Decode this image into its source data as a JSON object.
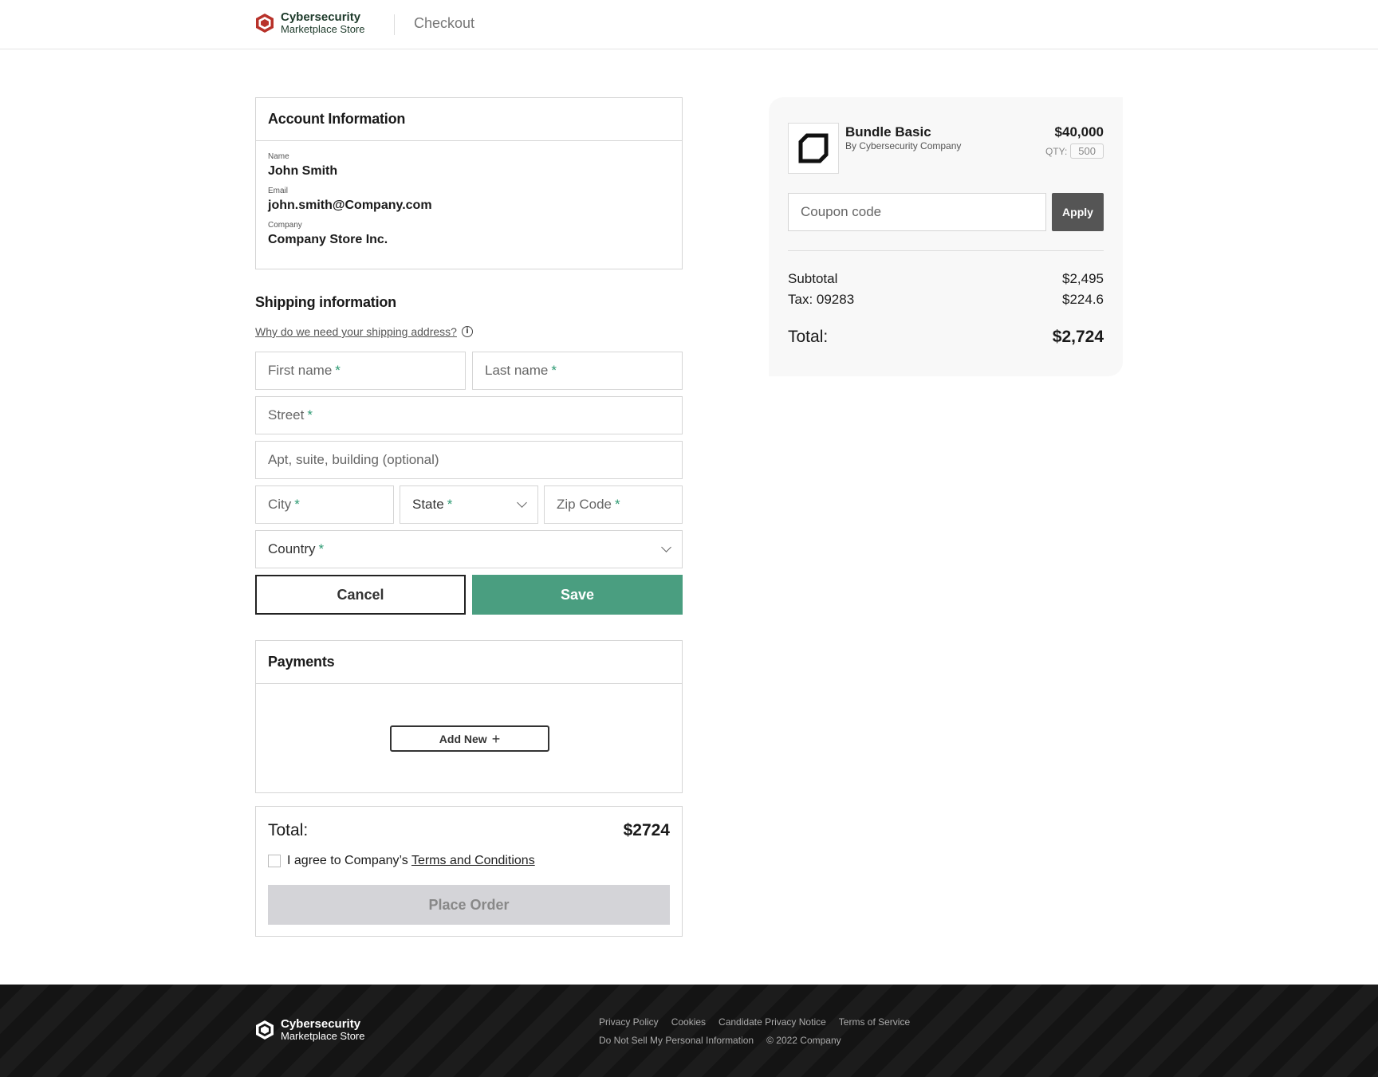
{
  "header": {
    "brand_line1": "Cybersecurity",
    "brand_line2": "Marketplace Store",
    "title": "Checkout"
  },
  "account": {
    "heading": "Account Information",
    "name_label": "Name",
    "name_value": "John Smith",
    "email_label": "Email",
    "email_value": "john.smith@Company.com",
    "company_label": "Company",
    "company_value": "Company Store Inc."
  },
  "shipping": {
    "heading": "Shipping information",
    "why_link": "Why do we need your shipping address?",
    "first_name": "First name",
    "last_name": "Last name",
    "street": "Street",
    "apt": "Apt, suite, building (optional)",
    "city": "City",
    "state": "State",
    "zip": "Zip Code",
    "country": "Country",
    "required_mark": "*",
    "cancel": "Cancel",
    "save": "Save"
  },
  "payments": {
    "heading": "Payments",
    "add_new": "Add New",
    "add_icon": "+"
  },
  "order": {
    "total_label": "Total:",
    "total_value": "$2724",
    "agree_text": "I agree to Company’s",
    "terms_link": "Terms and Conditions",
    "place_order": "Place Order"
  },
  "summary": {
    "product_name": "Bundle Basic",
    "product_by": "By Cybersecurity Company",
    "product_price": "$40,000",
    "qty_label": "QTY:",
    "qty_value": "500",
    "coupon_placeholder": "Coupon code",
    "apply": "Apply",
    "subtotal_label": "Subtotal",
    "subtotal_value": "$2,495",
    "tax_label": "Tax: 09283",
    "tax_value": "$224.6",
    "total_label": "Total:",
    "total_value": "$2,724"
  },
  "footer": {
    "brand_line1": "Cybersecurity",
    "brand_line2": "Marketplace Store",
    "links_row1": [
      "Privacy Policy",
      "Cookies",
      "Candidate Privacy Notice",
      "Terms of Service"
    ],
    "links_row2": [
      "Do Not Sell My Personal Information",
      "© 2022 Company"
    ]
  },
  "colors": {
    "accent_green": "#4a9e80",
    "brand_red": "#b8322a",
    "footer_bg": "#141414"
  }
}
